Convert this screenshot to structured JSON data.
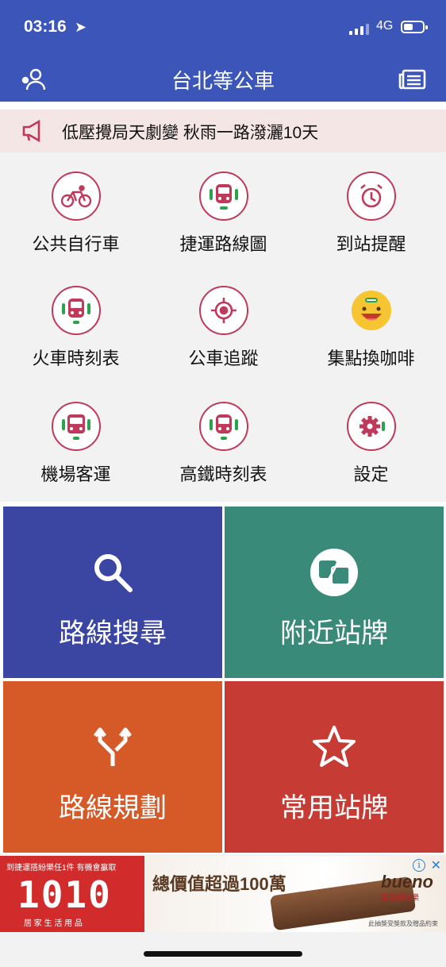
{
  "status_bar": {
    "time": "03:16",
    "network": "4G"
  },
  "header": {
    "title": "台北等公車"
  },
  "notice": {
    "text": "低壓攪局天劇變 秋雨一路潑灑10天"
  },
  "functions": [
    {
      "label": "公共自行車",
      "icon": "bicycle-icon"
    },
    {
      "label": "捷運路線圖",
      "icon": "metro-icon"
    },
    {
      "label": "到站提醒",
      "icon": "alarm-clock-icon"
    },
    {
      "label": "火車時刻表",
      "icon": "train-icon"
    },
    {
      "label": "公車追蹤",
      "icon": "crosshair-icon"
    },
    {
      "label": "集點換咖啡",
      "icon": "smiley-icon"
    },
    {
      "label": "機場客運",
      "icon": "airport-bus-icon"
    },
    {
      "label": "高鐵時刻表",
      "icon": "high-speed-rail-icon"
    },
    {
      "label": "設定",
      "icon": "gear-icon"
    }
  ],
  "tiles": [
    {
      "label": "路線搜尋",
      "icon": "search-icon",
      "color": "#3b46a3"
    },
    {
      "label": "附近站牌",
      "icon": "nearby-stops-icon",
      "color": "#3a8a7a"
    },
    {
      "label": "路線規劃",
      "icon": "route-split-icon",
      "color": "#d65a28"
    },
    {
      "label": "常用站牌",
      "icon": "star-icon",
      "color": "#c63c34"
    }
  ],
  "ad": {
    "left_top": "到捷運搭紛樂任1件 有機會贏取",
    "left_big": "1010",
    "left_bottom": "居 家 生 活 用 品",
    "headline": "總價值超過100萬",
    "brand": "bueno",
    "brand_sub": "健達繽紛樂",
    "fine_print": "此抽獎受獎款及贈品約束"
  },
  "colors": {
    "header": "#3b55b8",
    "accent": "#c0395b",
    "notice_bg": "#f5e6e6"
  }
}
